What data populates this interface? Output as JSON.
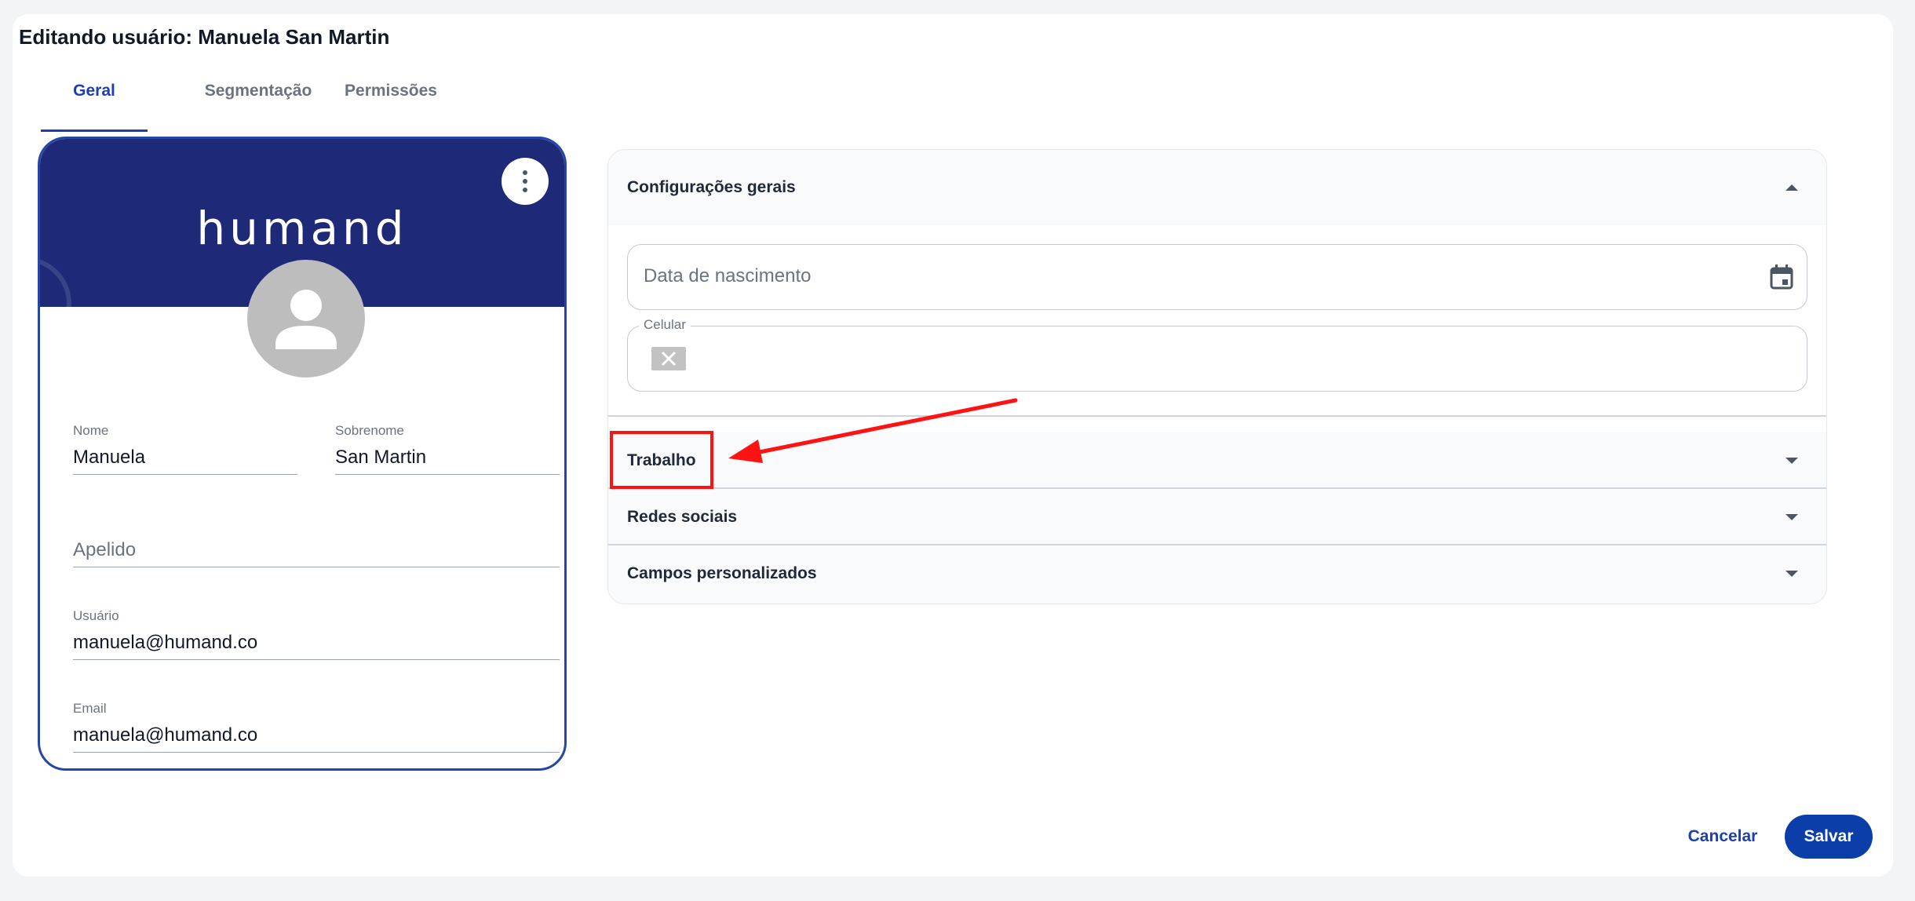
{
  "page": {
    "title": "Editando usuário: Manuela San Martin"
  },
  "tabs": [
    {
      "label": "Geral",
      "active": true
    },
    {
      "label": "Segmentação",
      "active": false
    },
    {
      "label": "Permissões",
      "active": false
    }
  ],
  "card": {
    "brand": "humand",
    "menu_icon": "more-vertical-icon",
    "avatar_icon": "person-icon",
    "fields": {
      "nome": {
        "label": "Nome",
        "value": "Manuela"
      },
      "sobrenome": {
        "label": "Sobrenome",
        "value": "San Martin"
      },
      "apelido": {
        "placeholder": "Apelido"
      },
      "usuario": {
        "label": "Usuário",
        "value": "manuela@humand.co"
      },
      "email": {
        "label": "Email",
        "value": "manuela@humand.co"
      }
    }
  },
  "accordion": {
    "general": {
      "title": "Configurações gerais",
      "expanded": true,
      "birthdate": {
        "placeholder": "Data de nascimento",
        "icon": "calendar-icon"
      },
      "phone": {
        "label": "Celular",
        "flag_icon": "broken-flag-icon"
      }
    },
    "sections": [
      {
        "title": "Trabalho",
        "expanded": false
      },
      {
        "title": "Redes sociais",
        "expanded": false
      },
      {
        "title": "Campos personalizados",
        "expanded": false
      }
    ]
  },
  "annotation": {
    "color": "#ff1212"
  },
  "colors": {
    "primary": "#0b3ea8",
    "banner": "#1e2a78",
    "accent_text": "#1e40af"
  },
  "actions": {
    "cancel": "Cancelar",
    "save": "Salvar"
  }
}
